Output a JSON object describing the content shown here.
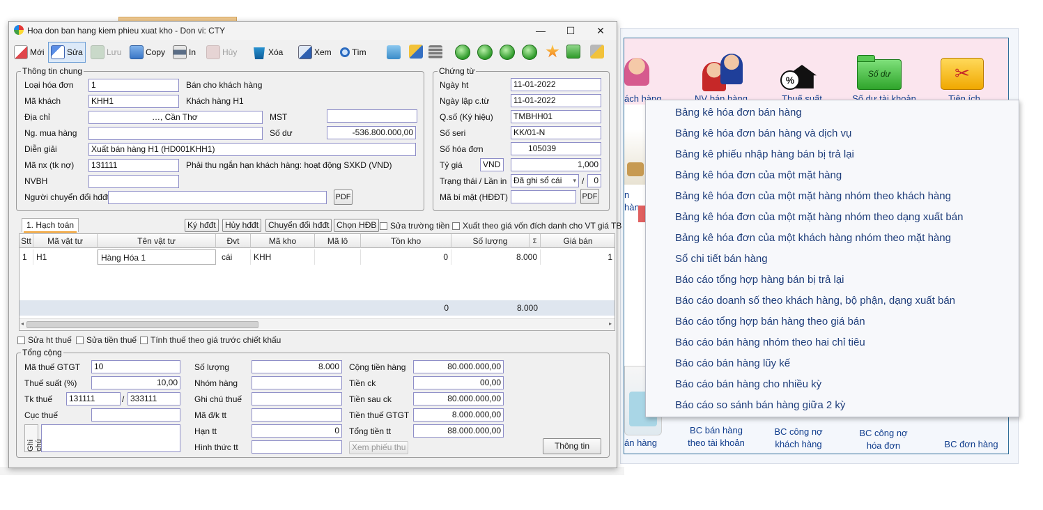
{
  "dialog": {
    "title": "Hoa don ban hang kiem phieu xuat kho - Don vi: CTY",
    "window_buttons": [
      "—",
      "☐",
      "✕"
    ]
  },
  "toolbar": {
    "new": "Mới",
    "edit": "Sửa",
    "save": "Lưu",
    "copy": "Copy",
    "print": "In",
    "cancel": "Hủy",
    "delete": "Xóa",
    "view": "Xem",
    "find": "Tìm"
  },
  "general": {
    "legend": "Thông tin chung",
    "invoice_type_label": "Loại hóa đơn",
    "invoice_type_value": "1",
    "invoice_type_desc": "Bán cho khách hàng",
    "customer_code_label": "Mã khách",
    "customer_code_value": "KHH1",
    "customer_name": "Khách hàng H1",
    "address_label": "Địa chỉ",
    "address_value": "…, Cần Thơ",
    "tax_code_label": "MST",
    "buyer_label": "Ng. mua hàng",
    "balance_label": "Số dư",
    "balance_value": "-536.800.000,00",
    "desc_label": "Diễn giải",
    "desc_value": "Xuất bán hàng H1 (HD001KHH1)",
    "account_label": "Mã nx (tk nợ)",
    "account_value": "131111",
    "account_desc": "Phải thu ngắn hạn khách hàng: hoạt động SXKD (VND)",
    "salesman_label": "NVBH",
    "converter_label": "Người chuyển đổi hđđt",
    "pdf": "PDF"
  },
  "voucher": {
    "legend": "Chứng từ",
    "date_label": "Ngày ht",
    "date_value": "11-01-2022",
    "doc_date_label": "Ngày lập c.từ",
    "doc_date_value": "11-01-2022",
    "series_label": "Q.số (Ký hiệu)",
    "series_value": "TMBHH01",
    "serial_label": "Số seri",
    "serial_value": "KK/01-N",
    "invoice_no_label": "Số hóa đơn",
    "invoice_no_value": "105039",
    "rate_label": "Tỷ giá",
    "currency": "VND",
    "rate_value": "1,000",
    "status_label": "Trạng thái / Lần in",
    "status_value": "Đã ghi sổ cái",
    "print_count": "0",
    "secret_label": "Mã bí mật (HĐĐT)",
    "pdf": "PDF"
  },
  "actions": {
    "sign": "Ký hđđt",
    "cancel_inv": "Hủy hđđt",
    "convert": "Chuyển đổi hđđt",
    "choose": "Chọn HĐB",
    "edit_field": "Sửa trường tiền",
    "export_cost": "Xuất theo giá vốn đích danh cho VT giá TB"
  },
  "tab": {
    "label": "1. Hạch toán"
  },
  "grid": {
    "headers": [
      "Stt",
      "Mã vật tư",
      "Tên vật tư",
      "Đvt",
      "Mã kho",
      "Mã lô",
      "Tồn kho",
      "Số lượng",
      "Σ",
      "Giá bán"
    ],
    "row": [
      "1",
      "H1",
      "Hàng Hóa 1",
      "cái",
      "KHH",
      "",
      "0",
      "8.000",
      "",
      "1"
    ],
    "sum_stock": "0",
    "sum_qty": "8.000"
  },
  "checks": {
    "edit_tax_ht": "Sửa ht thuế",
    "edit_tax_amount": "Sửa tiền thuế",
    "tax_before_discount": "Tính thuế theo giá trước chiết khấu"
  },
  "totals": {
    "legend": "Tổng cộng",
    "vat_code_label": "Mã thuế GTGT",
    "vat_code_value": "10",
    "vat_rate_label": "Thuế suất (%)",
    "vat_rate_value": "10,00",
    "tax_acc_label": "Tk thuế",
    "tax_acc_1": "131111",
    "tax_acc_2": "333111",
    "tax_dept_label": "Cục thuế",
    "note_label": "Ghi chú",
    "qty_label": "Số lượng",
    "qty_value": "8.000",
    "group_label": "Nhóm hàng",
    "tax_note_label": "Ghi chú thuế",
    "dk_label": "Mã đ/k tt",
    "due_label": "Hạn tt",
    "due_value": "0",
    "pay_method_label": "Hình thức tt",
    "goods_total_label": "Cộng tiền hàng",
    "goods_total_value": "80.000.000,00",
    "discount_label": "Tiền ck",
    "discount_value": "00,00",
    "after_discount_label": "Tiền sau ck",
    "after_discount_value": "80.000.000,00",
    "vat_amount_label": "Tiền thuế GTGT",
    "vat_amount_value": "8.000.000,00",
    "grand_total_label": "Tổng tiền tt",
    "grand_total_value": "88.000.000,00",
    "view_receipt": "Xem phiếu thu",
    "info": "Thông tin"
  },
  "bg": {
    "top_labels": [
      "ách hàng",
      "NV bán hàng",
      "Thuế suất",
      "Số dư tài khoản",
      "Tiện ích"
    ],
    "folder_text": "Số dư",
    "side_label": "n hàng",
    "bottom_labels": [
      "án hàng",
      "BC bán hàng\ntheo tài khoản",
      "BC công nợ\nkhách hàng",
      "BC công nợ\nhóa đơn",
      "BC đơn hàng"
    ]
  },
  "menu": {
    "items": [
      "Bảng kê hóa đơn bán hàng",
      "Bảng kê hóa đơn bán hàng và dịch vụ",
      "Bảng kê phiếu nhập hàng bán bị trả lại",
      "Bảng kê hóa đơn của một mặt hàng",
      "Bảng kê hóa đơn của một mặt hàng nhóm theo khách hàng",
      "Bảng kê hóa đơn của một mặt hàng nhóm theo dạng xuất bán",
      "Bảng kê hóa đơn của một khách hàng nhóm theo mặt hàng",
      "Sổ chi tiết bán hàng",
      "Báo cáo tổng hợp hàng bán bị trả lại",
      "Báo cáo doanh số theo khách hàng, bộ phận, dạng xuất bán",
      "Báo cáo tổng hợp bán hàng theo giá bán",
      "Báo cáo bán hàng nhóm theo hai chỉ tiêu",
      "Báo cáo bán hàng lũy kế",
      "Báo cáo bán hàng cho nhiều kỳ",
      "Báo cáo so sánh bán hàng giữa 2 kỳ"
    ]
  }
}
